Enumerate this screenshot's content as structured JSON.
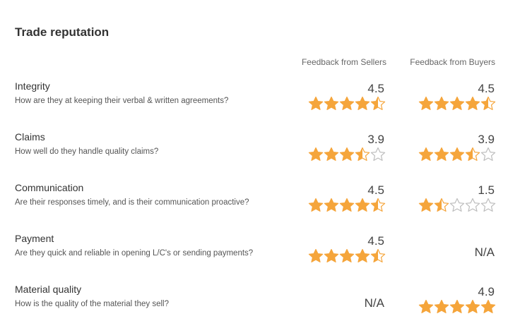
{
  "title": "Trade reputation",
  "columns": {
    "sellers": "Feedback from Sellers",
    "buyers": "Feedback from Buyers"
  },
  "colors": {
    "star_filled": "#f5a53b",
    "star_empty": "#bdbdbd"
  },
  "criteria": [
    {
      "name": "Integrity",
      "description": "How are they at keeping their verbal & written agreements?",
      "sellers": {
        "score": "4.5",
        "rating": 4.5
      },
      "buyers": {
        "score": "4.5",
        "rating": 4.5
      }
    },
    {
      "name": "Claims",
      "description": "How well do they handle quality claims?",
      "sellers": {
        "score": "3.9",
        "rating": 3.5
      },
      "buyers": {
        "score": "3.9",
        "rating": 3.5
      }
    },
    {
      "name": "Communication",
      "description": "Are their responses timely, and is their communication proactive?",
      "sellers": {
        "score": "4.5",
        "rating": 4.5
      },
      "buyers": {
        "score": "1.5",
        "rating": 1.5
      }
    },
    {
      "name": "Payment",
      "description": "Are they quick and reliable in opening L/C's or sending payments?",
      "sellers": {
        "score": "4.5",
        "rating": 4.5
      },
      "buyers": {
        "score": "N/A",
        "rating": null
      }
    },
    {
      "name": "Material quality",
      "description": "How is the quality of the material they sell?",
      "sellers": {
        "score": "N/A",
        "rating": null
      },
      "buyers": {
        "score": "4.9",
        "rating": 5
      }
    }
  ]
}
